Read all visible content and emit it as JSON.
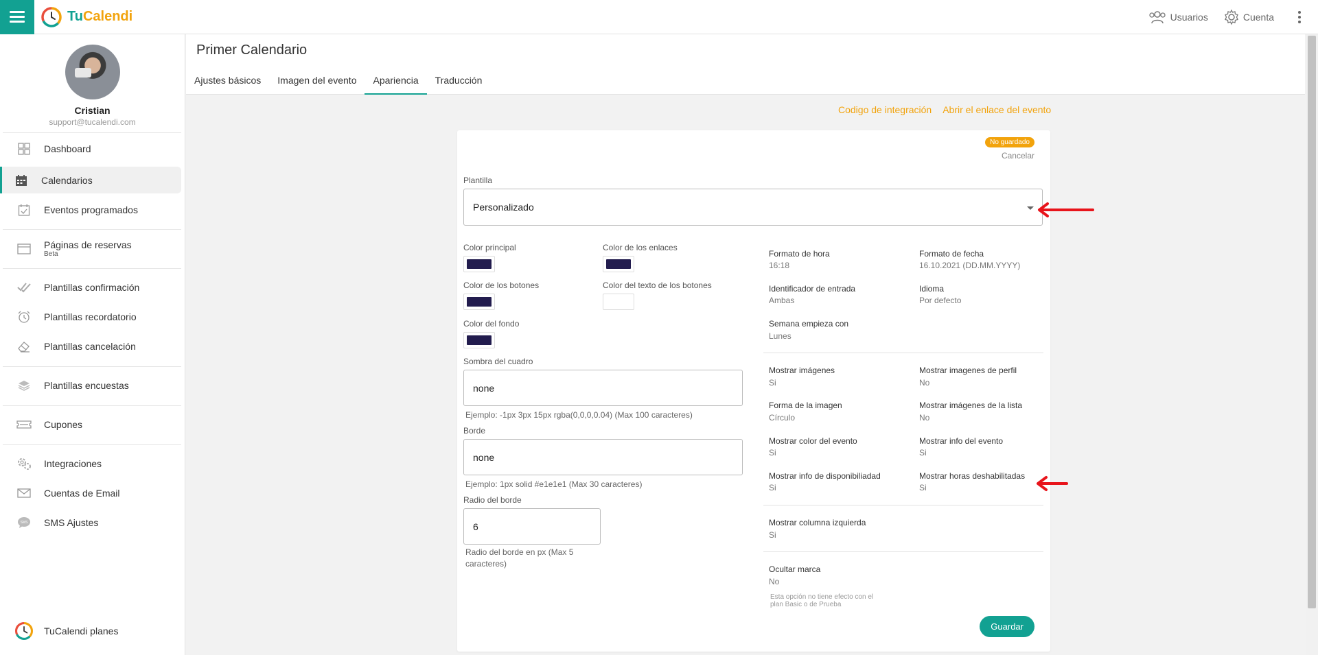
{
  "app": {
    "logo_tu": "Tu",
    "logo_cal": "Calendi"
  },
  "topbar": {
    "users_label": "Usuarios",
    "account_label": "Cuenta"
  },
  "profile": {
    "name": "Cristian",
    "email": "support@tucalendi.com"
  },
  "sidebar": {
    "items": [
      {
        "label": "Dashboard",
        "icon": "dashboard-icon"
      },
      {
        "label": "Calendarios",
        "icon": "calendar-icon"
      },
      {
        "label": "Eventos programados",
        "icon": "calendar-check-icon"
      },
      {
        "label": "Páginas de reservas",
        "sub": "Beta",
        "icon": "browser-window-icon"
      },
      {
        "label": "Plantillas confirmación",
        "icon": "double-check-icon"
      },
      {
        "label": "Plantillas recordatorio",
        "icon": "alarm-clock-icon"
      },
      {
        "label": "Plantillas cancelación",
        "icon": "eraser-icon"
      },
      {
        "label": "Plantillas encuestas",
        "icon": "layers-icon"
      },
      {
        "label": "Cupones",
        "icon": "ticket-icon"
      },
      {
        "label": "Integraciones",
        "icon": "gears-icon"
      },
      {
        "label": "Cuentas de Email",
        "icon": "envelope-icon"
      },
      {
        "label": "SMS Ajustes",
        "icon": "sms-bubble-icon"
      }
    ],
    "plans_label": "TuCalendi planes"
  },
  "page": {
    "title": "Primer Calendario",
    "tabs": [
      "Ajustes básicos",
      "Imagen del evento",
      "Apariencia",
      "Traducción"
    ],
    "active_tab": "Apariencia"
  },
  "links": {
    "integration": "Codigo de integración",
    "open_event": "Abrir el enlace del evento"
  },
  "card": {
    "badge": "No guardado",
    "cancel": "Cancelar",
    "template_label": "Plantilla",
    "template_value": "Personalizado",
    "colors": {
      "main_label": "Color principal",
      "main_value": "#221c4e",
      "links_label": "Color de los enlaces",
      "links_value": "#221c4e",
      "buttons_label": "Color de los botones",
      "buttons_value": "#221c4e",
      "button_text_label": "Color del texto de los botones",
      "button_text_value": "#ffffff",
      "background_label": "Color del fondo",
      "background_value": "#221c4e"
    },
    "shadow": {
      "label": "Sombra del cuadro",
      "value": "none",
      "hint": "Ejemplo: -1px 3px 15px rgba(0,0,0,0.04) (Max 100 caracteres)"
    },
    "border": {
      "label": "Borde",
      "value": "none",
      "hint": "Ejemplo: 1px solid #e1e1e1 (Max 30 caracteres)"
    },
    "radius": {
      "label": "Radio del borde",
      "value": "6",
      "hint_line1": "Radio del borde en px (Max 5",
      "hint_line2": "caracteres)"
    },
    "options": {
      "hour_format": {
        "label": "Formato de hora",
        "value": "16:18"
      },
      "date_format": {
        "label": "Formato de fecha",
        "value": "16.10.2021 (DD.MM.YYYY)"
      },
      "input_id": {
        "label": "Identificador de entrada",
        "value": "Ambas"
      },
      "language": {
        "label": "Idioma",
        "value": "Por defecto"
      },
      "week_start": {
        "label": "Semana empieza con",
        "value": "Lunes"
      },
      "show_images": {
        "label": "Mostrar imágenes",
        "value": "Si"
      },
      "show_profile_images": {
        "label": "Mostrar imagenes de perfil",
        "value": "No"
      },
      "image_shape": {
        "label": "Forma de la imagen",
        "value": "Círculo"
      },
      "show_list_images": {
        "label": "Mostrar imágenes de la lista",
        "value": "No"
      },
      "show_event_color": {
        "label": "Mostrar color del evento",
        "value": "Si"
      },
      "show_event_info": {
        "label": "Mostrar info del evento",
        "value": "Si"
      },
      "show_availability": {
        "label": "Mostrar info de disponibiliadad",
        "value": "Si"
      },
      "show_disabled_hours": {
        "label": "Mostrar horas deshabilitadas",
        "value": "Si"
      },
      "show_left_column": {
        "label": "Mostrar columna izquierda",
        "value": "Si"
      },
      "hide_brand": {
        "label": "Ocultar marca",
        "value": "No"
      }
    },
    "hide_brand_note_line1": "Esta opción no tiene efecto con el",
    "hide_brand_note_line2": "plan Basic o de Prueba",
    "save_label": "Guardar"
  },
  "theme": {
    "accent": "#12a192",
    "orange": "#f2a30c",
    "annotation": "#e8141b"
  }
}
